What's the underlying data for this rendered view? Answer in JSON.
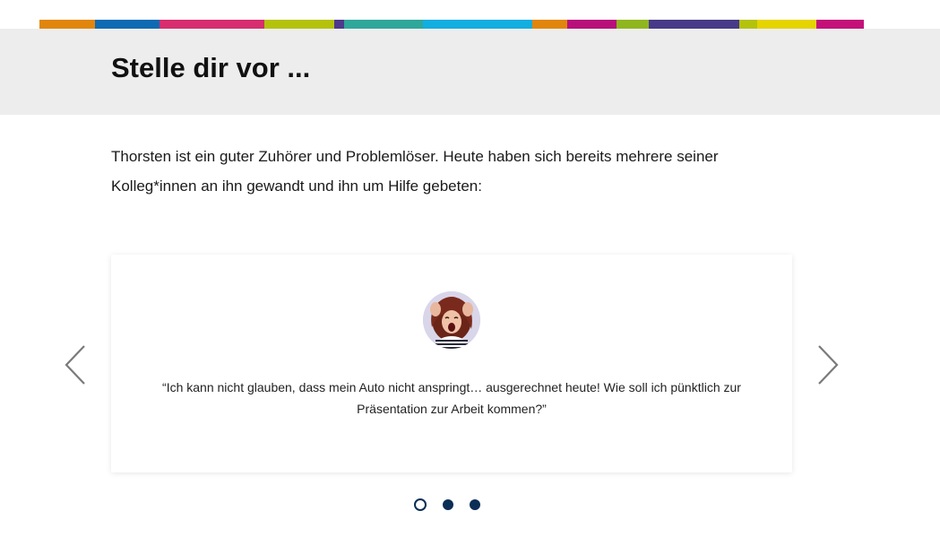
{
  "brand_colors": [
    "#e1860c",
    "#0e6ab3",
    "#d62e6e",
    "#b4c20c",
    "#4d3a8c",
    "#2fa79a",
    "#12aee0",
    "#e1860c",
    "#b8107a",
    "#8fb61f",
    "#483a88",
    "#b4c20c",
    "#e5d400",
    "#c4117a"
  ],
  "header": {
    "title": "Stelle dir vor ..."
  },
  "intro": {
    "text": "Thorsten ist ein guter Zuhörer und Problemlöser. Heute haben sich bereits mehrere seiner Kolleg*innen an ihn gewandt und ihn um Hilfe gebeten:"
  },
  "carousel": {
    "current_slide": 1,
    "slide_count": 3,
    "slide": {
      "avatar_icon": "stressed-woman-avatar",
      "quote": "“Ich kann nicht glauben, dass mein Auto nicht anspringt… ausgerechnet heute! Wie soll ich pünktlich zur Präsentation zur Arbeit kommen?”"
    },
    "prev_icon": "chevron-left-icon",
    "next_icon": "chevron-right-icon",
    "dot_color": "#0a2e55"
  }
}
